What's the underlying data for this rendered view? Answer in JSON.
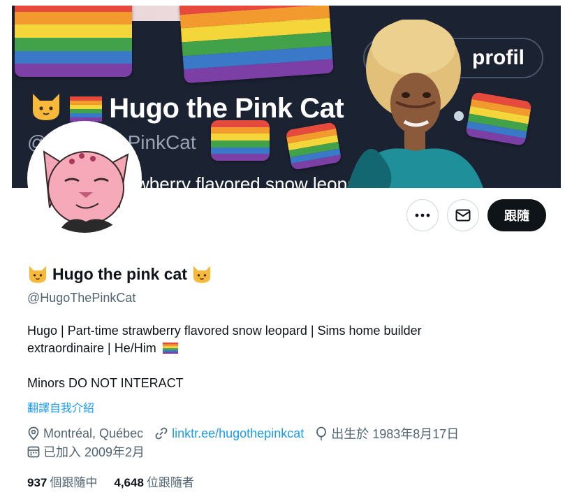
{
  "banner": {
    "name": "Hugo the Pink Cat",
    "handle_partial": "@HugoThePinkCat",
    "bio_partial": "Part-time strawberry flavored snow leopard |",
    "pill_label": "profil"
  },
  "profile": {
    "display_name": "Hugo the pink cat",
    "handle": "@HugoThePinkCat",
    "bio_line1": "Hugo | Part-time strawberry flavored snow leopard | Sims home builder",
    "bio_line2": "extraordinaire | He/Him",
    "bio_line3": "Minors DO NOT INTERACT",
    "translate_label": "翻譯自我介紹",
    "location": "Montréal, Québec",
    "website": "linktr.ee/hugothepinkcat",
    "birthday": "出生於 1983年8月17日",
    "joined": "已加入 2009年2月",
    "following_count": "937",
    "following_label": "個跟隨中",
    "followers_count": "4,648",
    "followers_label": "位跟隨者"
  },
  "actions": {
    "more_label": "•••",
    "follow_label": "跟隨"
  },
  "icons": [
    "cat-emoji-icon",
    "rainbow-flag-icon",
    "more-icon",
    "mail-icon",
    "location-icon",
    "link-icon",
    "birthday-icon",
    "calendar-icon"
  ],
  "colors": {
    "accent": "#1d9bf0",
    "text": "#0f1419",
    "muted": "#536471",
    "follow_button": "#0f1419"
  }
}
